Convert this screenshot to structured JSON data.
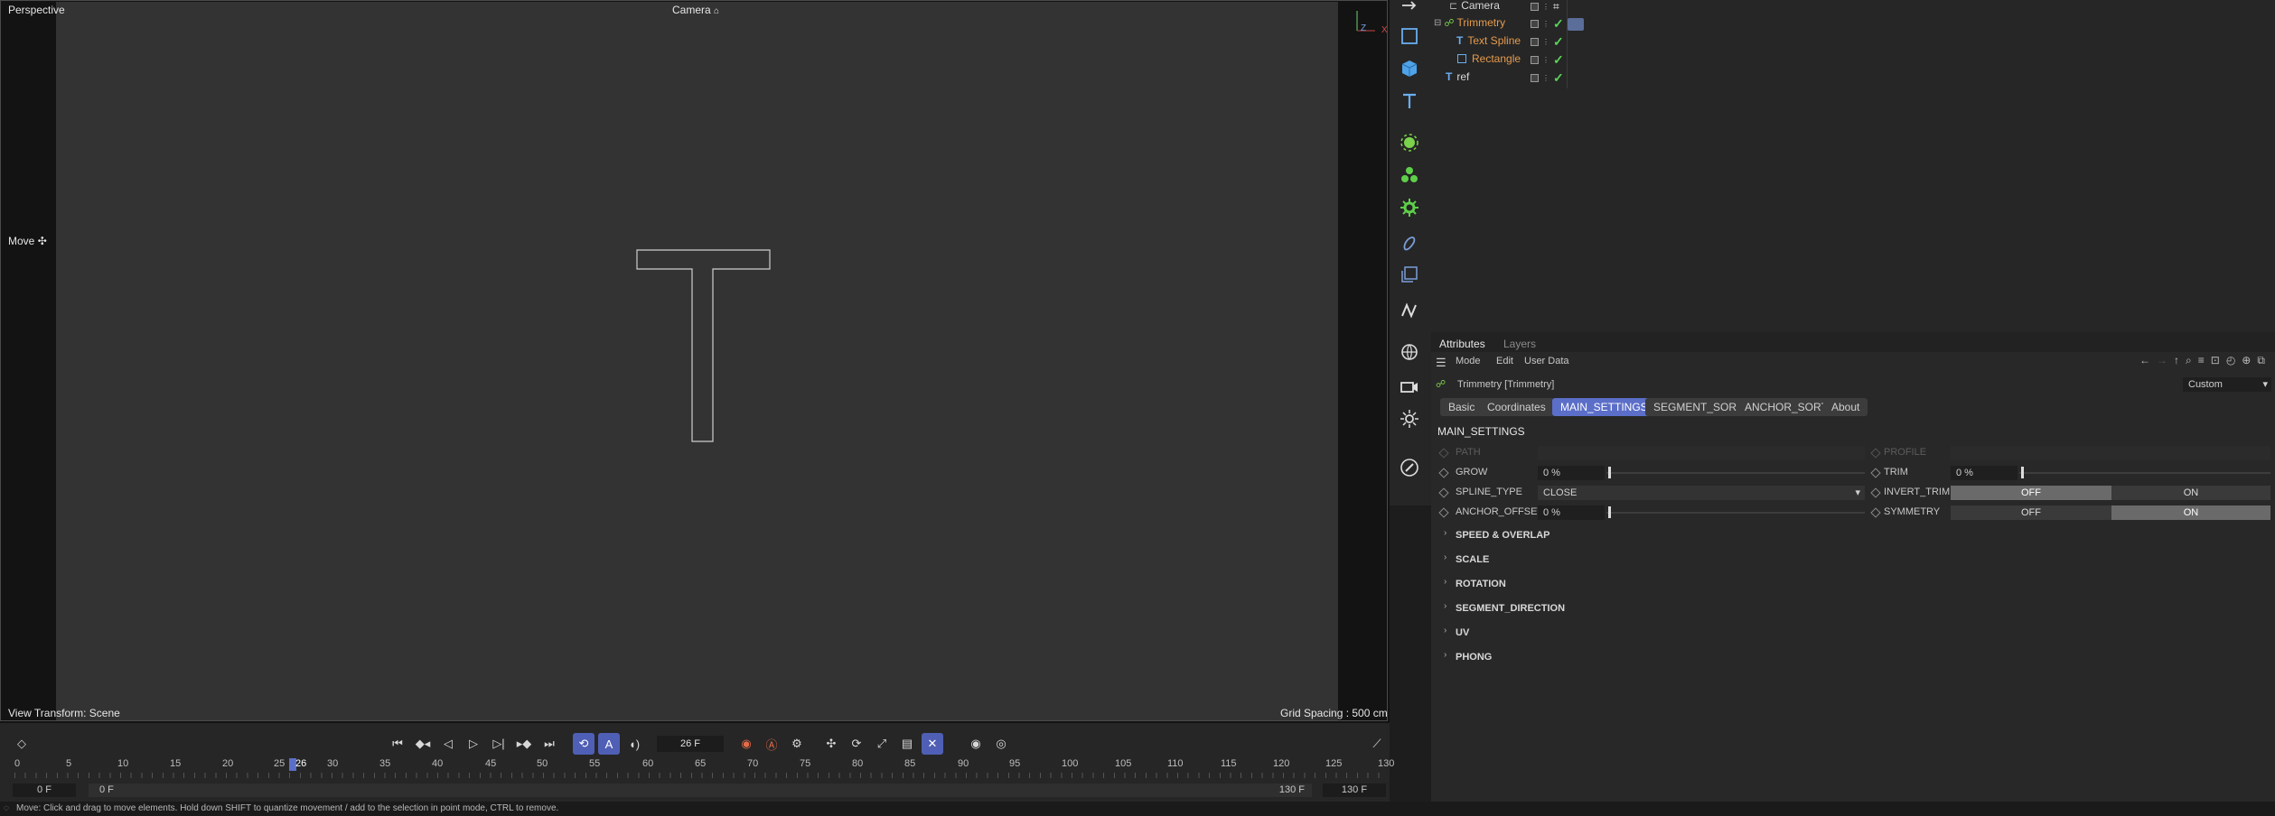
{
  "viewport": {
    "view_name": "Perspective",
    "camera_label": "Camera",
    "tool_label": "Move",
    "view_transform": "View Transform: Scene",
    "grid_spacing": "Grid Spacing : 500 cm",
    "axis_z": "Z",
    "axis_x": "X"
  },
  "objects": [
    {
      "name": "Camera",
      "color": "#d8d8d8"
    },
    {
      "name": "Trimmetry",
      "color": "#e59b4e"
    },
    {
      "name": "Text Spline",
      "color": "#e59b4e"
    },
    {
      "name": "Rectangle",
      "color": "#e59b4e"
    },
    {
      "name": "ref",
      "color": "#d8d8d8"
    }
  ],
  "attributes": {
    "tabs": [
      "Attributes",
      "Layers"
    ],
    "menu": [
      "Mode",
      "Edit",
      "User Data"
    ],
    "object_title": "Trimmetry [Trimmetry]",
    "preset": "Custom",
    "chips": [
      "Basic",
      "Coordinates",
      "MAIN_SETTINGS",
      "SEGMENT_SORT",
      "ANCHOR_SORT",
      "About"
    ],
    "section_title": "MAIN_SETTINGS",
    "params": {
      "path": "PATH",
      "profile": "PROFILE",
      "grow_label": "GROW",
      "grow_value": "0 %",
      "trim_label": "TRIM",
      "trim_value": "0 %",
      "spline_type_label": "SPLINE_TYPE",
      "spline_type_value": "CLOSE",
      "invert_trim_label": "INVERT_TRIM",
      "anchor_offset_label": "ANCHOR_OFFSET",
      "anchor_offset_value": "0 %",
      "symmetry_label": "SYMMETRY",
      "off": "OFF",
      "on": "ON"
    },
    "groups": [
      "SPEED & OVERLAP",
      "SCALE",
      "ROTATION",
      "SEGMENT_DIRECTION",
      "UV",
      "PHONG"
    ]
  },
  "timeline": {
    "current_frame": "26 F",
    "start_frame": "0 F",
    "start_frame_2": "0 F",
    "end_frame": "130 F",
    "end_frame_2": "130 F",
    "ticks": [
      "0",
      "5",
      "10",
      "15",
      "20",
      "25",
      "26",
      "30",
      "35",
      "40",
      "45",
      "50",
      "55",
      "60",
      "65",
      "70",
      "75",
      "80",
      "85",
      "90",
      "95",
      "100",
      "105",
      "110",
      "115",
      "120",
      "125",
      "130"
    ]
  },
  "status": {
    "message": "Move: Click and drag to move elements. Hold down SHIFT to quantize movement / add to the selection in point mode, CTRL to remove."
  },
  "colors": {
    "accent": "#5b6ec8",
    "object_orange": "#e59b4e",
    "check_green": "#5bd45b"
  }
}
